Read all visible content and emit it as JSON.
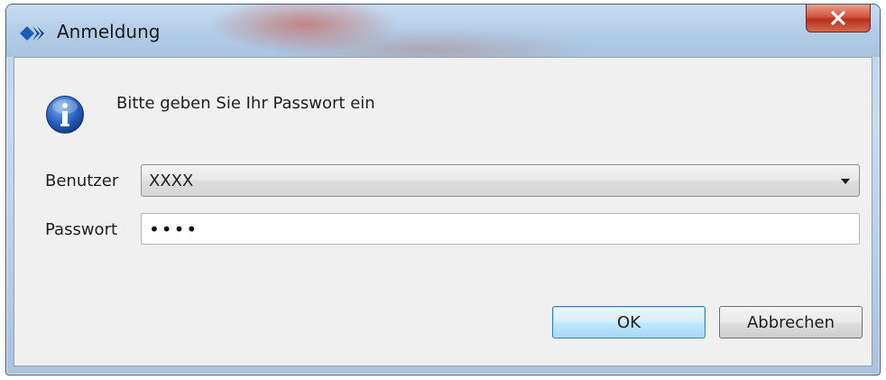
{
  "window": {
    "title": "Anmeldung",
    "close_label": "x"
  },
  "dialog": {
    "message": "Bitte geben Sie Ihr Passwort ein",
    "user": {
      "label": "Benutzer",
      "selected_value": "XXXX"
    },
    "password": {
      "label": "Passwort",
      "value": "••••"
    }
  },
  "buttons": {
    "ok_label": "OK",
    "cancel_label": "Abbrechen"
  },
  "icons": {
    "app": "app-logo-icon",
    "info": "info-icon",
    "close": "close-icon",
    "dropdown": "chevron-down-icon"
  },
  "colors": {
    "info_blue": "#2a64c4",
    "ok_border": "#3c7fb1",
    "close_red": "#c7402a"
  }
}
